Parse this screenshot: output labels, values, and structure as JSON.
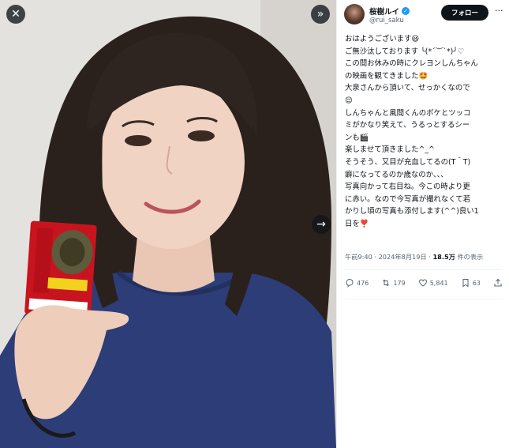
{
  "viewer": {
    "close_icon": "close-icon",
    "expand_icon": "double-chevron-right-icon",
    "next_icon": "arrow-right-icon"
  },
  "header": {
    "display_name": "桜樹ルイ",
    "handle": "@rui_saku",
    "follow_label": "フォロー",
    "more_label": "···"
  },
  "post": {
    "lines": [
      "おはようございます😃",
      "ご無沙汰しております ╰(*´︶`*)╯♡",
      "この間お休みの時にクレヨンしんちゃん",
      "の映画を観てきました🤩",
      "大泉さんから頂いて、せっかくなので",
      "😌",
      "しんちゃんと風間くんのボケとツッコ",
      "ミがかなり笑えて、うるっとするシー",
      "ンも🎬",
      "楽しませて頂きました^_^",
      "そうそう、又目が充血してるの(T＾T)",
      "癖になってるのか歳なのか、、、",
      "写真向かって右目ね。今この時より更",
      "に赤い。なので今写真が撮れなくて若",
      "かりし頃の写真も添付します(^^)良い1",
      "日を❣️"
    ],
    "time": "午前9:40",
    "date": "2024年8月19日",
    "views": "18.5万",
    "views_suffix": "件の表示"
  },
  "actions": {
    "replies": "476",
    "reposts": "179",
    "likes": "5,841",
    "bookmarks": "63"
  },
  "colors": {
    "accent": "#1d9bf0",
    "text": "#0f1419",
    "muted": "#536471",
    "follow_bg": "#0f1419",
    "shirt": "#2c3d78",
    "card_red": "#c8141e"
  }
}
